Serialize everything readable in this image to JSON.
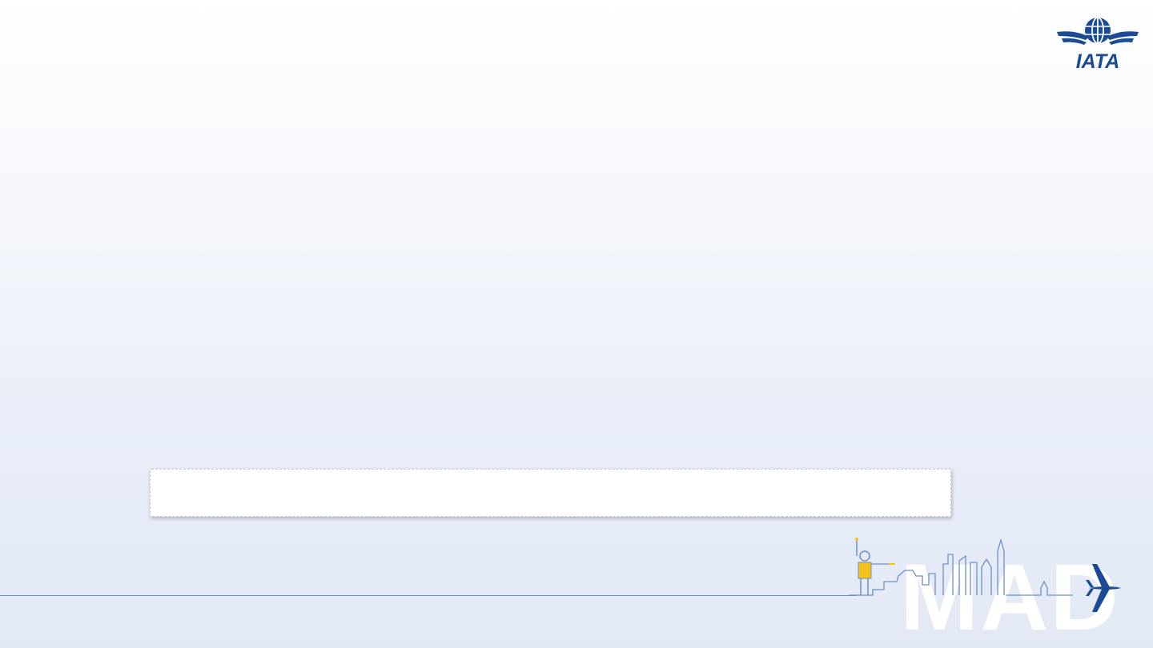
{
  "logo": {
    "text": "IATA",
    "color": "#1a4b94",
    "icon": "globe-wings-icon"
  },
  "caption": {
    "text": ""
  },
  "city_banner": {
    "code": "MAD",
    "code_color": "#ffffff",
    "line_color": "#6f8fc1",
    "accent_color": "#f3c11a",
    "plane_color": "#1a4b94",
    "icons": [
      "ground-crew-icon",
      "madrid-skyline-icon",
      "airplane-icon"
    ]
  }
}
